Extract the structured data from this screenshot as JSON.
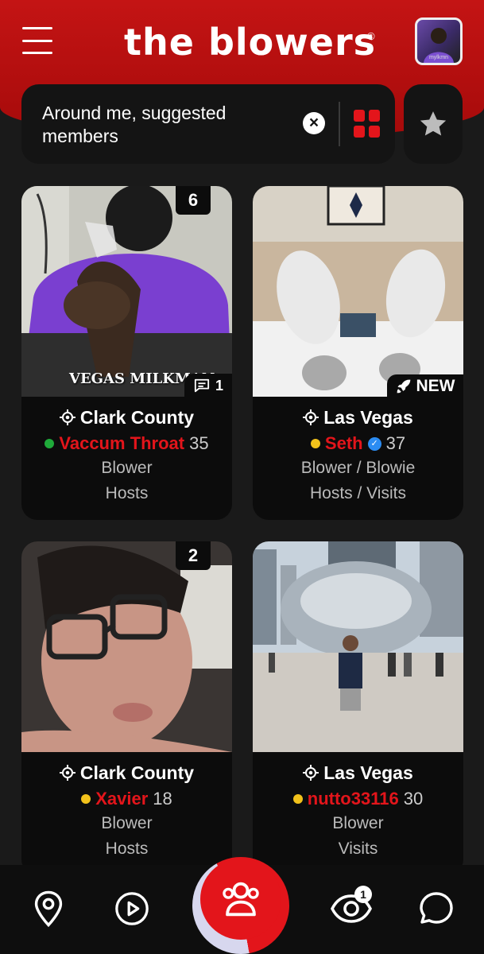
{
  "header": {
    "logo_text": "the blowers",
    "logo_mark": "©",
    "avatar_name": "mylkmn"
  },
  "search": {
    "text": "Around me, suggested members"
  },
  "icons": {
    "menu": "hamburger-icon",
    "clear": "close-circle-icon",
    "grid": "grid-icon",
    "favorites": "star-icon",
    "location": "crosshair-icon",
    "comment": "comment-icon",
    "new": "rocket-icon",
    "nav_map": "map-pin-icon",
    "nav_videos": "play-icon",
    "nav_members": "people-icon",
    "nav_views": "eye-icon",
    "nav_chat": "chat-icon"
  },
  "colors": {
    "accent": "#e3151b",
    "online": "#1faa3a",
    "away": "#f2c21b"
  },
  "members": [
    {
      "location": "Clark County",
      "name": "Vaccum Throat",
      "age": "35",
      "status": "online",
      "verified": false,
      "role": "Blower",
      "hosting": "Hosts",
      "photo_count": "6",
      "comments": "1",
      "photo_watermark": "VEGAS MILKMAN"
    },
    {
      "location": "Las Vegas",
      "name": "Seth",
      "age": "37",
      "status": "away",
      "verified": true,
      "role": "Blower / Blowie",
      "hosting": "Hosts / Visits",
      "new_label": "NEW"
    },
    {
      "location": "Clark County",
      "name": "Xavier",
      "age": "18",
      "status": "away",
      "verified": false,
      "role": "Blower",
      "hosting": "Hosts",
      "photo_count": "2"
    },
    {
      "location": "Las Vegas",
      "name": "nutto33116",
      "age": "30",
      "status": "away",
      "verified": false,
      "role": "Blower",
      "hosting": "Visits"
    }
  ],
  "bottom_nav": {
    "views_badge": "1"
  }
}
